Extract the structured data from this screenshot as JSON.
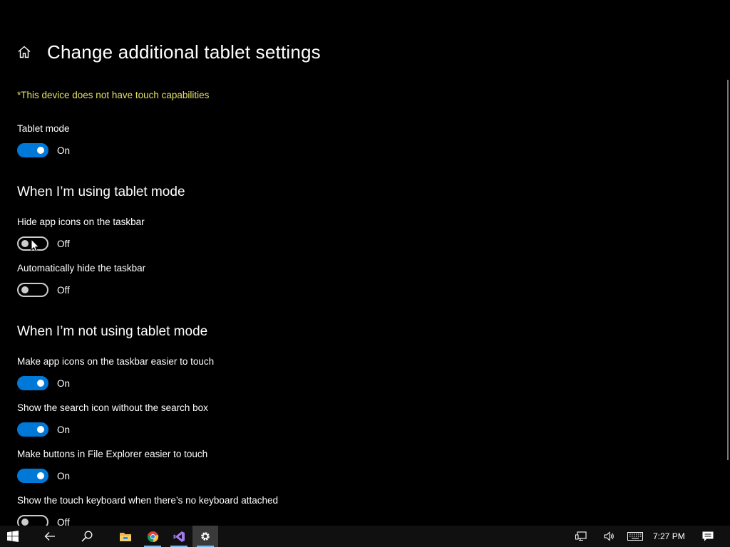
{
  "header": {
    "title": "Change additional tablet settings"
  },
  "notice": "*This device does not have touch capabilities",
  "tablet_mode": {
    "label": "Tablet mode",
    "state": "On"
  },
  "section_using": {
    "heading": "When I’m using tablet mode",
    "settings": [
      {
        "label": "Hide app icons on the taskbar",
        "state": "Off"
      },
      {
        "label": "Automatically hide the taskbar",
        "state": "Off"
      }
    ]
  },
  "section_not_using": {
    "heading": "When I’m not using tablet mode",
    "settings": [
      {
        "label": "Make app icons on the taskbar easier to touch",
        "state": "On"
      },
      {
        "label": "Show the search icon without the search box",
        "state": "On"
      },
      {
        "label": "Make buttons in File Explorer easier to touch",
        "state": "On"
      },
      {
        "label": "Show the touch keyboard when there’s no keyboard attached",
        "state": "Off"
      }
    ]
  },
  "taskbar": {
    "apps": [
      "start-icon",
      "back-icon",
      "search-icon",
      "file-explorer-icon",
      "chrome-icon",
      "visual-studio-icon",
      "settings-icon"
    ],
    "tray": [
      "network-icon",
      "volume-icon",
      "touch-keyboard-icon",
      "action-center-icon"
    ],
    "clock": "7:27 PM"
  },
  "colors": {
    "accent": "#0078d7",
    "notice": "#e6e06a",
    "background": "#000000",
    "taskbar": "#101010"
  }
}
